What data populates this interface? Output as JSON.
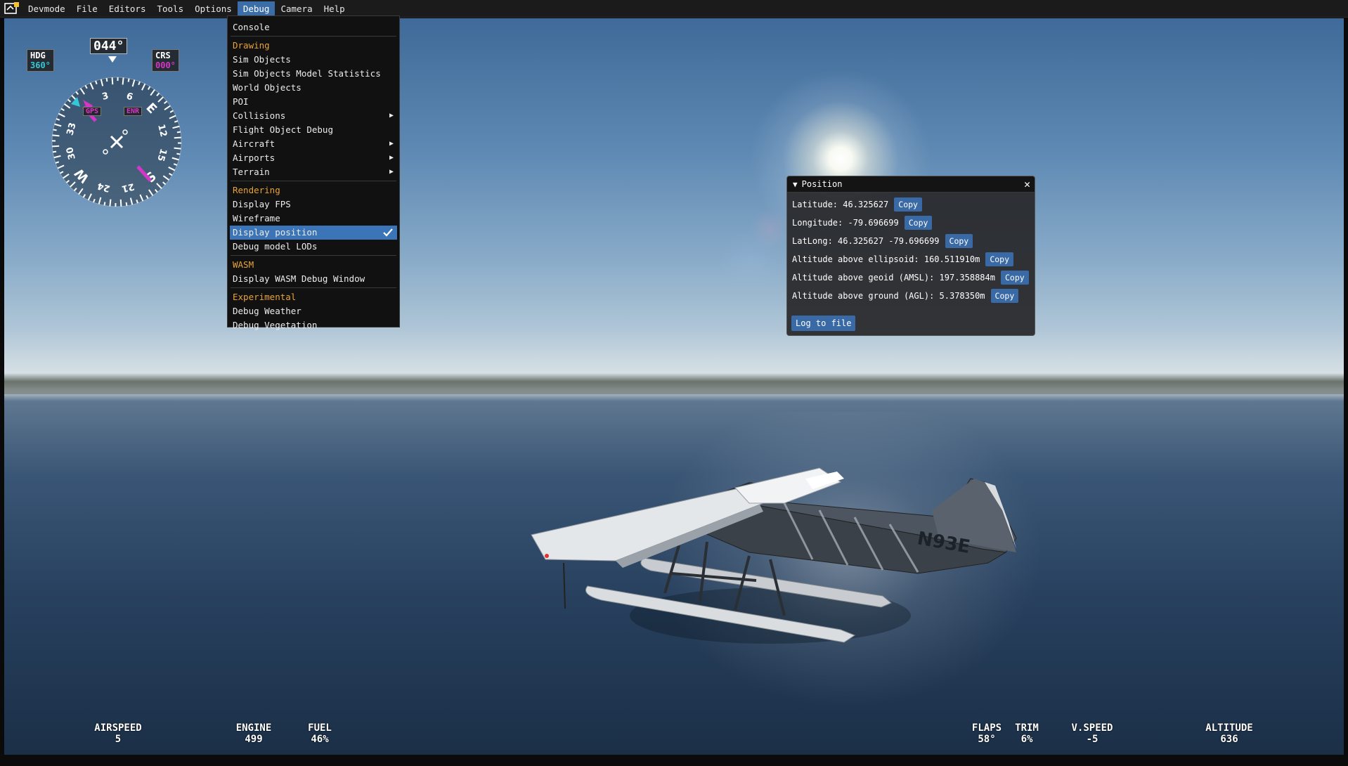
{
  "menubar": {
    "items": [
      "Devmode",
      "File",
      "Editors",
      "Tools",
      "Options",
      "Debug",
      "Camera",
      "Help"
    ],
    "active": "Debug"
  },
  "debug_menu": {
    "console": "Console",
    "section_drawing": "Drawing",
    "sim_objects": "Sim Objects",
    "sim_objects_model_statistics": "Sim Objects Model Statistics",
    "world_objects": "World Objects",
    "poi": "POI",
    "collisions": "Collisions",
    "flight_object_debug": "Flight Object Debug",
    "aircraft": "Aircraft",
    "airports": "Airports",
    "terrain": "Terrain",
    "section_rendering": "Rendering",
    "display_fps": "Display FPS",
    "wireframe": "Wireframe",
    "display_position": "Display position",
    "debug_model_lods": "Debug model LODs",
    "section_wasm": "WASM",
    "display_wasm_debug_window": "Display WASM Debug Window",
    "section_experimental": "Experimental",
    "debug_weather": "Debug Weather",
    "debug_vegetation": "Debug Vegetation"
  },
  "position_panel": {
    "title": "Position",
    "copy_label": "Copy",
    "latitude": "Latitude: 46.325627",
    "longitude": "Longitude: -79.696699",
    "latlong": "LatLong: 46.325627 -79.696699",
    "alt_ellipsoid": "Altitude above ellipsoid: 160.511910m",
    "alt_geoid": "Altitude above geoid (AMSL): 197.358884m",
    "alt_ground": "Altitude above ground (AGL): 5.378350m",
    "log_button": "Log to file"
  },
  "hsi": {
    "heading_readout": "044°",
    "hdg_label": "HDG",
    "hdg_value": "360°",
    "crs_label": "CRS",
    "crs_value": "000°",
    "gps_label": "GPS",
    "enr_label": "ENR",
    "card_labels": [
      "3",
      "6",
      "E",
      "12",
      "15",
      "S",
      "21",
      "24",
      "W",
      "30",
      "33"
    ]
  },
  "aircraft": {
    "registration": "N93E"
  },
  "telemetry": {
    "airspeed_label": "AIRSPEED",
    "airspeed_value": "5",
    "engine_label": "ENGINE",
    "engine_value": "499",
    "fuel_label": "FUEL",
    "fuel_value": "46%",
    "flaps_label": "FLAPS",
    "flaps_value": "58°",
    "trim_label": "TRIM",
    "trim_value": "6%",
    "vspeed_label": "V.SPEED",
    "vspeed_value": "-5",
    "altitude_label": "ALTITUDE",
    "altitude_value": "636"
  },
  "colors": {
    "menu_highlight": "#3c74b8",
    "section_header": "#e8a33a",
    "copy_button": "#3a6aa6",
    "hdg_cyan": "#35c7d6",
    "crs_magenta": "#d636c8"
  }
}
